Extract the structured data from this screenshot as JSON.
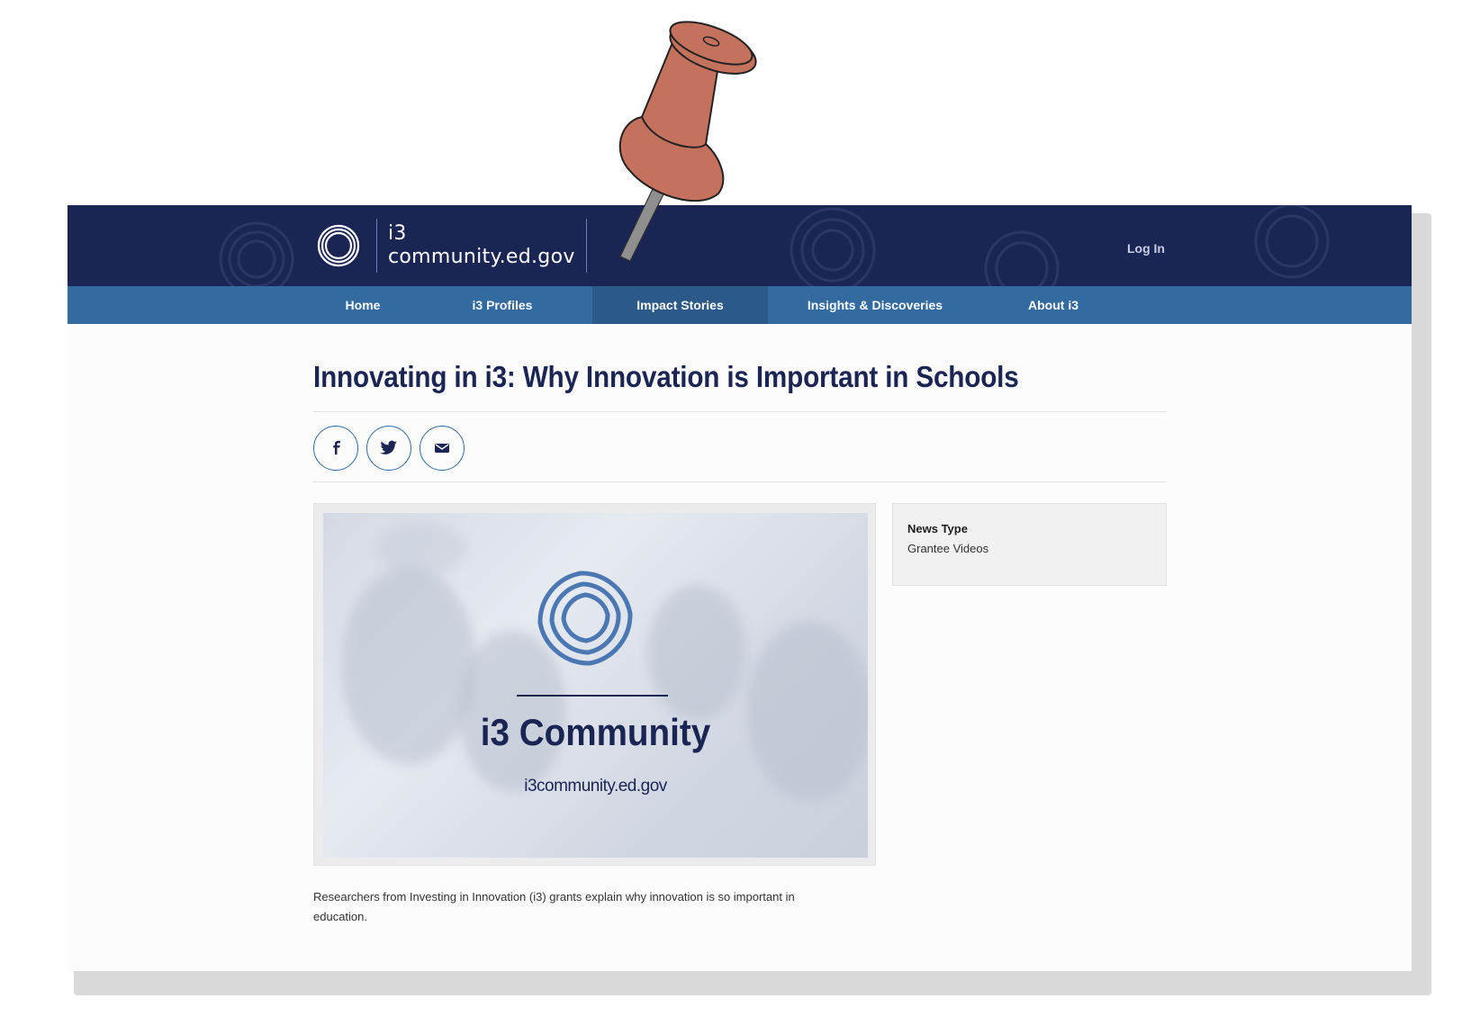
{
  "site": {
    "logo_line1": "i3",
    "logo_line2": "community.ed.gov",
    "login_label": "Log In"
  },
  "nav": {
    "items": [
      {
        "label": "Home"
      },
      {
        "label": "i3 Profiles"
      },
      {
        "label": "Impact Stories",
        "active": true
      },
      {
        "label": "Insights & Discoveries"
      },
      {
        "label": "About i3"
      }
    ]
  },
  "article": {
    "title": "Innovating in i3: Why Innovation is Important in Schools",
    "share": [
      {
        "icon": "facebook-icon"
      },
      {
        "icon": "twitter-icon"
      },
      {
        "icon": "email-icon"
      }
    ],
    "media": {
      "title": "i3 Community",
      "url": "i3community.ed.gov"
    },
    "body": "Researchers from Investing in Innovation (i3) grants explain why innovation is so important in education."
  },
  "sidebar": {
    "news_type_label": "News Type",
    "news_type_value": "Grantee Videos"
  },
  "colors": {
    "header_bg": "#1b2554",
    "nav_bg": "#336aa0",
    "nav_active_bg": "#2b5988",
    "title_color": "#1b2554",
    "pin_color": "#c4725e"
  }
}
